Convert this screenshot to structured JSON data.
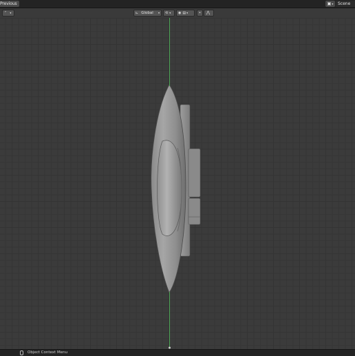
{
  "topbar": {
    "previous_label": "Previous",
    "scene_label": "Scene"
  },
  "header": {
    "transform_orientation": "Global"
  },
  "statusbar": {
    "hint": "Object Context Menu"
  },
  "colors": {
    "background": "#393939",
    "z_axis": "#4fa657",
    "model_gray": "#9a9a9a"
  }
}
